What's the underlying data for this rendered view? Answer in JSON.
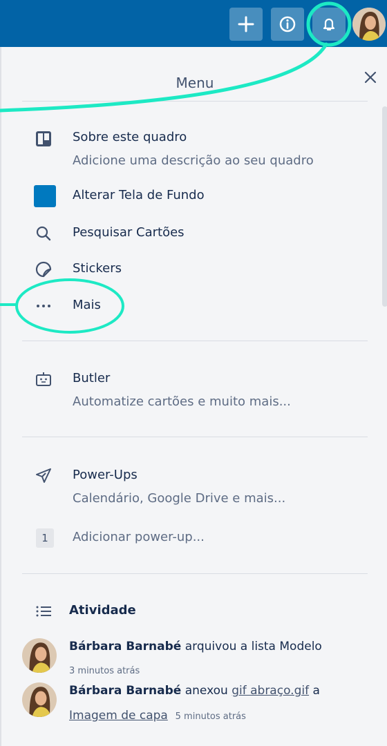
{
  "header": {
    "colors": {
      "bar": "#0263a6",
      "highlight": "#1de9c4"
    },
    "buttons": [
      "plus-icon",
      "info-icon",
      "bell-icon"
    ]
  },
  "menu": {
    "title": "Menu",
    "close_icon": "close-icon",
    "items": [
      {
        "icon": "board-icon",
        "title": "Sobre este quadro",
        "subtitle": "Adicione uma descrição ao seu quadro"
      },
      {
        "icon": "color-swatch",
        "title": "Alterar Tela de Fundo",
        "color": "#0079bf"
      },
      {
        "icon": "search-icon",
        "title": "Pesquisar Cartões"
      },
      {
        "icon": "sticker-icon",
        "title": "Stickers"
      },
      {
        "icon": "more-icon",
        "title": "Mais"
      }
    ],
    "butler": {
      "icon": "robot-icon",
      "title": "Butler",
      "subtitle": "Automatize cartões e muito mais..."
    },
    "powerups": {
      "icon": "rocket-icon",
      "title": "Power-Ups",
      "subtitle": "Calendário, Google Drive e mais...",
      "count": "1",
      "add_label": "Adicionar power-up..."
    },
    "activity": {
      "title": "Atividade",
      "entries": [
        {
          "user": "Bárbara Barnabé",
          "text": " arquivou a lista Modelo",
          "time": "3 minutos atrás"
        },
        {
          "user": "Bárbara Barnabé",
          "text": " anexou ",
          "link": "gif abraço.gif",
          "text2": " a",
          "link2": "Imagem de capa",
          "time": "5 minutos atrás"
        }
      ]
    }
  }
}
